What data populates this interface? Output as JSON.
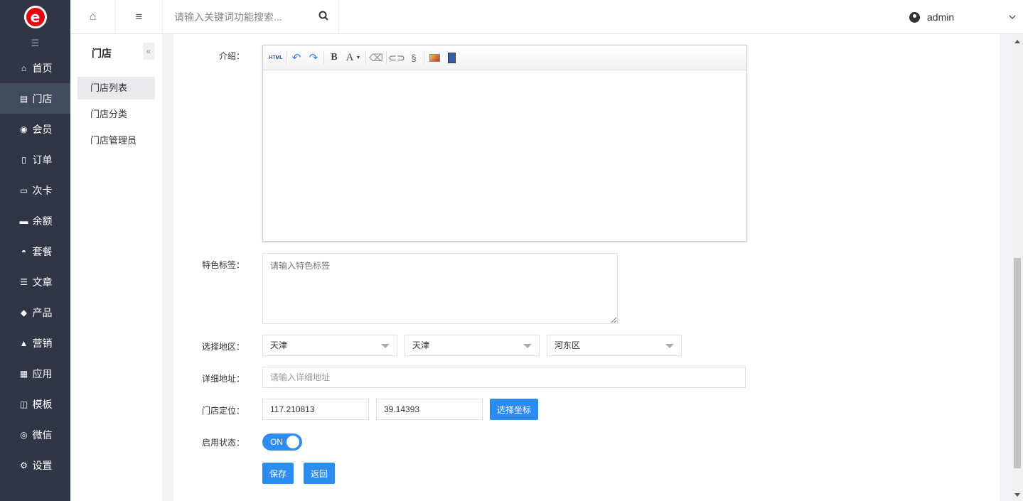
{
  "brand": {
    "logo_letter": "e",
    "accent": "#e60012"
  },
  "sidebar": {
    "items": [
      {
        "label": "首页",
        "icon": "home-icon",
        "glyph": "⌂"
      },
      {
        "label": "门店",
        "icon": "store-icon",
        "glyph": "▤"
      },
      {
        "label": "会员",
        "icon": "user-circle-icon",
        "glyph": "◉"
      },
      {
        "label": "订单",
        "icon": "document-icon",
        "glyph": "▯"
      },
      {
        "label": "次卡",
        "icon": "card-icon",
        "glyph": "▭"
      },
      {
        "label": "余额",
        "icon": "credit-card-icon",
        "glyph": "▬"
      },
      {
        "label": "套餐",
        "icon": "dashboard-icon",
        "glyph": "◓"
      },
      {
        "label": "文章",
        "icon": "list-icon",
        "glyph": "☰"
      },
      {
        "label": "产品",
        "icon": "tag-icon",
        "glyph": "◆"
      },
      {
        "label": "营销",
        "icon": "thumbs-up-icon",
        "glyph": "▲"
      },
      {
        "label": "应用",
        "icon": "apps-icon",
        "glyph": "▦"
      },
      {
        "label": "模板",
        "icon": "columns-icon",
        "glyph": "◫"
      },
      {
        "label": "微信",
        "icon": "wechat-icon",
        "glyph": "◎"
      },
      {
        "label": "设置",
        "icon": "gear-icon",
        "glyph": "⚙"
      }
    ]
  },
  "topbar": {
    "search_placeholder": "请输入关键词功能搜索...",
    "user": "admin"
  },
  "subnav": {
    "title": "门店",
    "items": [
      "门店列表",
      "门店分类",
      "门店管理员"
    ]
  },
  "form": {
    "intro_label": "介绍：",
    "tags_label": "特色标签：",
    "tags_placeholder": "请输入特色标签",
    "region_label": "选择地区：",
    "region_province": "天津",
    "region_city": "天津",
    "region_district": "河东区",
    "address_label": "详细地址：",
    "address_placeholder": "请输入详细地址",
    "location_label": "门店定位：",
    "longitude": "117.210813",
    "latitude": "39.14393",
    "pick_coord": "选择坐标",
    "status_label": "启用状态：",
    "status_on": "ON",
    "save": "保存",
    "back": "返回"
  },
  "editor_toolbar": {
    "html": "HTML",
    "bold": "B",
    "font_color": "A"
  }
}
